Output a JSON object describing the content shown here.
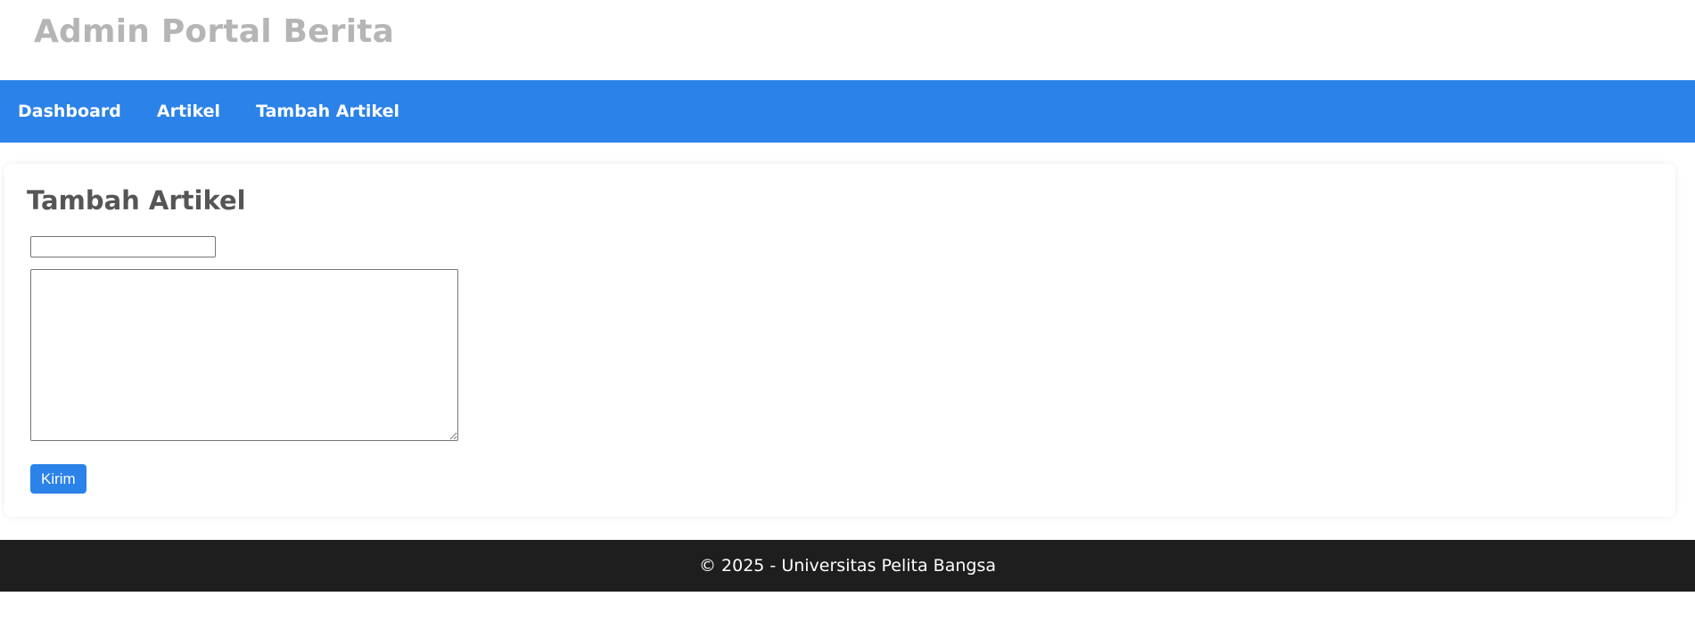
{
  "header": {
    "site_title": "Admin Portal Berita"
  },
  "nav": {
    "items": [
      {
        "label": "Dashboard"
      },
      {
        "label": "Artikel"
      },
      {
        "label": "Tambah Artikel"
      }
    ]
  },
  "form": {
    "page_title": "Tambah Artikel",
    "title_value": "",
    "title_placeholder": "",
    "content_value": "",
    "content_placeholder": "",
    "submit_label": "Kirim"
  },
  "footer": {
    "text": "© 2025 - Universitas Pelita Bangsa"
  },
  "colors": {
    "accent": "#2b82e8",
    "footer_bg": "#1e1e1e",
    "title_gray": "#b5b5b5",
    "heading_gray": "#555555"
  }
}
